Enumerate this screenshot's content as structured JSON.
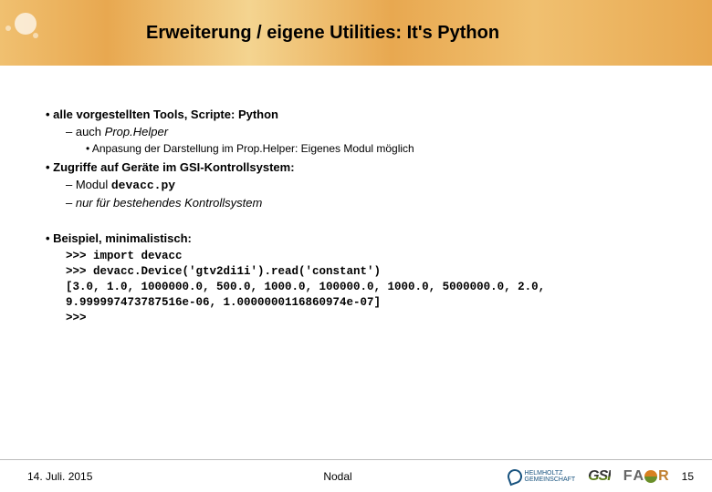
{
  "header": {
    "title": "Erweiterung / eigene Utilities: It's Python"
  },
  "body": {
    "b1_prefix": "alle vorgestellten Tools, Scripte: ",
    "b1_emph": "Python",
    "b1a_prefix": "auch ",
    "b1a_emph": "Prop.Helper",
    "b1a_i": "Anpasung der Darstellung im Prop.Helper: Eigenes Modul möglich",
    "b2": "Zugriffe auf Geräte im GSI-Kontrollsystem:",
    "b2a_prefix": "Modul ",
    "b2a_mono": "devacc.py",
    "b2b": "nur für bestehendes Kontrollsystem",
    "b3": "Beispiel, minimalistisch:",
    "code_l1": ">>> import devacc",
    "code_l2": ">>> devacc.Device('gtv2di1i').read('constant')",
    "code_l3": "[3.0, 1.0, 1000000.0, 500.0, 1000.0, 100000.0, 1000.0, 5000000.0, 2.0, 9.999997473787516e-06, 1.0000000116860974e-07]",
    "code_l4": ">>>"
  },
  "footer": {
    "date": "14. Juli. 2015",
    "center": "Nodal",
    "page_number": "15",
    "logos": {
      "helmholtz_line1": "HELMHOLTZ",
      "helmholtz_line2": "GEMEINSCHAFT",
      "gsi": "GSI",
      "fair_f": "F",
      "fair_a": "A",
      "fair_r": "R"
    }
  }
}
